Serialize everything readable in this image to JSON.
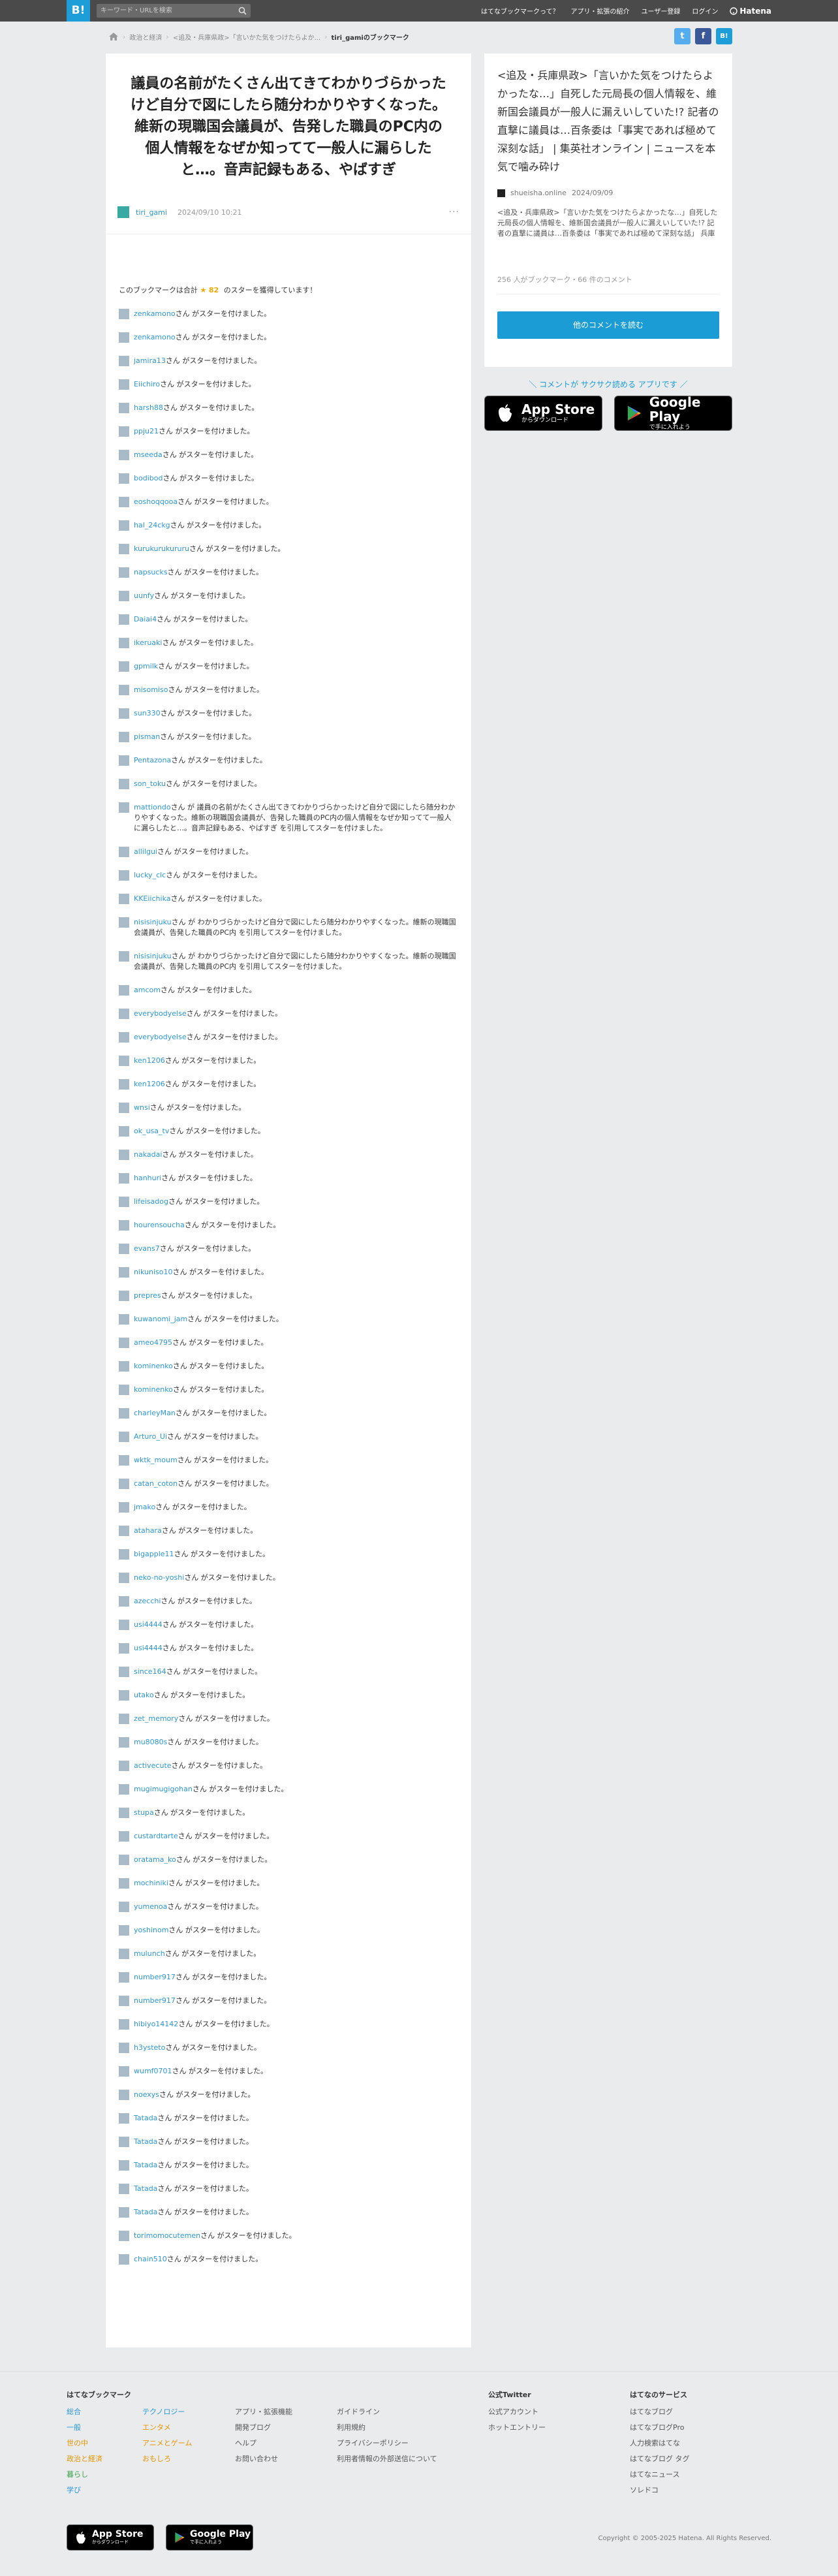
{
  "header": {
    "logo": "B!",
    "search_placeholder": "キーワード・URLを検索",
    "nav": [
      "はてなブックマークって？",
      "アプリ・拡張の紹介",
      "ユーザー登録",
      "ログイン"
    ],
    "brand": "Hatena"
  },
  "breadcrumb": [
    "政治と経済",
    "<追及・兵庫県政>「言いかた気をつけたらよか...",
    "tiri_gamiのブックマーク"
  ],
  "social": [
    "t",
    "f",
    "B!"
  ],
  "entry": {
    "title": "議員の名前がたくさん出てきてわかりづらかったけど自分で図にしたら随分わかりやすくなった。維新の現職国会議員が、告発した職員のPC内の個人情報をなぜか知ってて一般人に漏らしたと…。音声記録もある、やばすぎ",
    "user": "tiri_gami",
    "date": "2024/09/10 10:21",
    "more": "···"
  },
  "stars": {
    "prefix": "このブックマークは合計",
    "star_glyph": "★",
    "total": "82",
    "suffix": "のスターを獲得しています！",
    "list": [
      {
        "name": "zenkamono",
        "text": "さん がスターを付けました。"
      },
      {
        "name": "zenkamono",
        "text": "さん がスターを付けました。"
      },
      {
        "name": "jamira13",
        "text": "さん がスターを付けました。"
      },
      {
        "name": "Eiichiro",
        "text": "さん がスターを付けました。"
      },
      {
        "name": "harsh88",
        "text": "さん がスターを付けました。"
      },
      {
        "name": "ppju21",
        "text": "さん がスターを付けました。"
      },
      {
        "name": "mseeda",
        "text": "さん がスターを付けました。"
      },
      {
        "name": "bodibod",
        "text": "さん がスターを付けました。"
      },
      {
        "name": "eoshoqqooa",
        "text": "さん がスターを付けました。"
      },
      {
        "name": "hal_24ckg",
        "text": "さん がスターを付けました。"
      },
      {
        "name": "kurukurukururu",
        "text": "さん がスターを付けました。"
      },
      {
        "name": "napsucks",
        "text": "さん がスターを付けました。"
      },
      {
        "name": "uunfy",
        "text": "さん がスターを付けました。"
      },
      {
        "name": "Daiai4",
        "text": "さん がスターを付けました。"
      },
      {
        "name": "ikeruaki",
        "text": "さん がスターを付けました。"
      },
      {
        "name": "gpmilk",
        "text": "さん がスターを付けました。"
      },
      {
        "name": "misomiso",
        "text": "さん がスターを付けました。"
      },
      {
        "name": "sun330",
        "text": "さん がスターを付けました。"
      },
      {
        "name": "pisman",
        "text": "さん がスターを付けました。"
      },
      {
        "name": "Pentazona",
        "text": "さん がスターを付けました。"
      },
      {
        "name": "son_toku",
        "text": "さん がスターを付けました。"
      },
      {
        "name": "mattiondo",
        "text": "さん が 議員の名前がたくさん出てきてわかりづらかったけど自分で図にしたら随分わかりやすくなった。維新の現職国会議員が、告発した職員のPC内の個人情報をなぜか知ってて一般人に漏らしたと…。音声記録もある、やばすぎ を引用してスターを付けました。"
      },
      {
        "name": "allilgui",
        "text": "さん がスターを付けました。"
      },
      {
        "name": "lucky_clc",
        "text": "さん がスターを付けました。"
      },
      {
        "name": "KKEiichika",
        "text": "さん がスターを付けました。"
      },
      {
        "name": "nisisinjuku",
        "text": "さん が わかりづらかったけど自分で図にしたら随分わかりやすくなった。維新の現職国会議員が、告発した職員のPC内 を引用してスターを付けました。"
      },
      {
        "name": "nisisinjuku",
        "text": "さん が わかりづらかったけど自分で図にしたら随分わかりやすくなった。維新の現職国会議員が、告発した職員のPC内 を引用してスターを付けました。"
      },
      {
        "name": "amcom",
        "text": "さん がスターを付けました。"
      },
      {
        "name": "everybodyelse",
        "text": "さん がスターを付けました。"
      },
      {
        "name": "everybodyelse",
        "text": "さん がスターを付けました。"
      },
      {
        "name": "ken1206",
        "text": "さん がスターを付けました。"
      },
      {
        "name": "ken1206",
        "text": "さん がスターを付けました。"
      },
      {
        "name": "wnsi",
        "text": "さん がスターを付けました。"
      },
      {
        "name": "ok_usa_tv",
        "text": "さん がスターを付けました。"
      },
      {
        "name": "nakadai",
        "text": "さん がスターを付けました。"
      },
      {
        "name": "hanhuri",
        "text": "さん がスターを付けました。"
      },
      {
        "name": "lifeisadog",
        "text": "さん がスターを付けました。"
      },
      {
        "name": "hourensoucha",
        "text": "さん がスターを付けました。"
      },
      {
        "name": "evans7",
        "text": "さん がスターを付けました。"
      },
      {
        "name": "nikuniso10",
        "text": "さん がスターを付けました。"
      },
      {
        "name": "prepres",
        "text": "さん がスターを付けました。"
      },
      {
        "name": "kuwanomi_jam",
        "text": "さん がスターを付けました。"
      },
      {
        "name": "ameo4795",
        "text": "さん がスターを付けました。"
      },
      {
        "name": "kominenko",
        "text": "さん がスターを付けました。"
      },
      {
        "name": "kominenko",
        "text": "さん がスターを付けました。"
      },
      {
        "name": "charleyMan",
        "text": "さん がスターを付けました。"
      },
      {
        "name": "Arturo_Ui",
        "text": "さん がスターを付けました。"
      },
      {
        "name": "wktk_moum",
        "text": "さん がスターを付けました。"
      },
      {
        "name": "catan_coton",
        "text": "さん がスターを付けました。"
      },
      {
        "name": "jmako",
        "text": "さん がスターを付けました。"
      },
      {
        "name": "atahara",
        "text": "さん がスターを付けました。"
      },
      {
        "name": "bigapple11",
        "text": "さん がスターを付けました。"
      },
      {
        "name": "neko-no-yoshi",
        "text": "さん がスターを付けました。"
      },
      {
        "name": "azecchi",
        "text": "さん がスターを付けました。"
      },
      {
        "name": "usi4444",
        "text": "さん がスターを付けました。"
      },
      {
        "name": "usi4444",
        "text": "さん がスターを付けました。"
      },
      {
        "name": "since164",
        "text": "さん がスターを付けました。"
      },
      {
        "name": "utako",
        "text": "さん がスターを付けました。"
      },
      {
        "name": "zet_memory",
        "text": "さん がスターを付けました。"
      },
      {
        "name": "mu8080s",
        "text": "さん がスターを付けました。"
      },
      {
        "name": "activecute",
        "text": "さん がスターを付けました。"
      },
      {
        "name": "mugimugigohan",
        "text": "さん がスターを付けました。"
      },
      {
        "name": "stupa",
        "text": "さん がスターを付けました。"
      },
      {
        "name": "custardtarte",
        "text": "さん がスターを付けました。"
      },
      {
        "name": "oratama_ko",
        "text": "さん がスターを付けました。"
      },
      {
        "name": "mochiniki",
        "text": "さん がスターを付けました。"
      },
      {
        "name": "yumenoa",
        "text": "さん がスターを付けました。"
      },
      {
        "name": "yoshinom",
        "text": "さん がスターを付けました。"
      },
      {
        "name": "mulunch",
        "text": "さん がスターを付けました。"
      },
      {
        "name": "number917",
        "text": "さん がスターを付けました。"
      },
      {
        "name": "number917",
        "text": "さん がスターを付けました。"
      },
      {
        "name": "hibiyo14142",
        "text": "さん がスターを付けました。"
      },
      {
        "name": "h3ysteto",
        "text": "さん がスターを付けました。"
      },
      {
        "name": "wumf0701",
        "text": "さん がスターを付けました。"
      },
      {
        "name": "noexys",
        "text": "さん がスターを付けました。"
      },
      {
        "name": "Tatada",
        "text": "さん がスターを付けました。"
      },
      {
        "name": "Tatada",
        "text": "さん がスターを付けました。"
      },
      {
        "name": "Tatada",
        "text": "さん がスターを付けました。"
      },
      {
        "name": "Tatada",
        "text": "さん がスターを付けました。"
      },
      {
        "name": "Tatada",
        "text": "さん がスターを付けました。"
      },
      {
        "name": "torimomocutemen",
        "text": "さん がスターを付けました。"
      },
      {
        "name": "chain510",
        "text": "さん がスターを付けました。"
      }
    ]
  },
  "side": {
    "title": "<追及・兵庫県政>「言いかた気をつけたらよかったな…」自死した元局長の個人情報を、維新国会議員が一般人に漏えいしていた!? 記者の直撃に議員は…百条委は「事実であれば極めて深刻な話」 | 集英社オンライン | ニュースを本気で噛み砕け",
    "source": "shueisha.online",
    "date": "2024/09/09",
    "description": "<追及・兵庫県政>「言いかた気をつけたらよかったな…」自死した元局長の個人情報を、維新国会議員が一般人に漏えいしていた!? 記者の直撃に議員は…百条委は「事実であれば極めて深刻な話」 兵庫県の元西播磨県…",
    "counts": "256 人がブックマーク・66 件のコメント",
    "button": "他のコメントを読む",
    "promo": "＼ コメントが サクサク読める アプリです ／"
  },
  "stores": {
    "app_store_sub": "からダウンロード",
    "app_store": "App Store",
    "google_play_sub": "で手に入れよう",
    "google_play": "Google Play"
  },
  "footer": {
    "col1": {
      "title": "はてなブックマーク",
      "items": [
        "総合",
        "一般",
        "世の中",
        "政治と経済",
        "暮らし",
        "学び"
      ]
    },
    "col2": {
      "items": [
        "テクノロジー",
        "エンタメ",
        "アニメとゲーム",
        "おもしろ"
      ]
    },
    "col3": {
      "items": [
        "アプリ・拡張機能",
        "開発ブログ",
        "ヘルプ",
        "お問い合わせ"
      ]
    },
    "col4": {
      "items": [
        "ガイドライン",
        "利用規約",
        "プライバシーポリシー",
        "利用者情報の外部送信について"
      ]
    },
    "col5": {
      "title": "公式Twitter",
      "items": [
        "公式アカウント",
        "ホットエントリー"
      ]
    },
    "col6": {
      "title": "はてなのサービス",
      "items": [
        "はてなブログ",
        "はてなブログPro",
        "人力検索はてな",
        "はてなブログ タグ",
        "はてなニュース",
        "ソレドコ"
      ]
    },
    "copyright": "Copyright © 2005-2025 Hatena. All Rights Reserved."
  }
}
